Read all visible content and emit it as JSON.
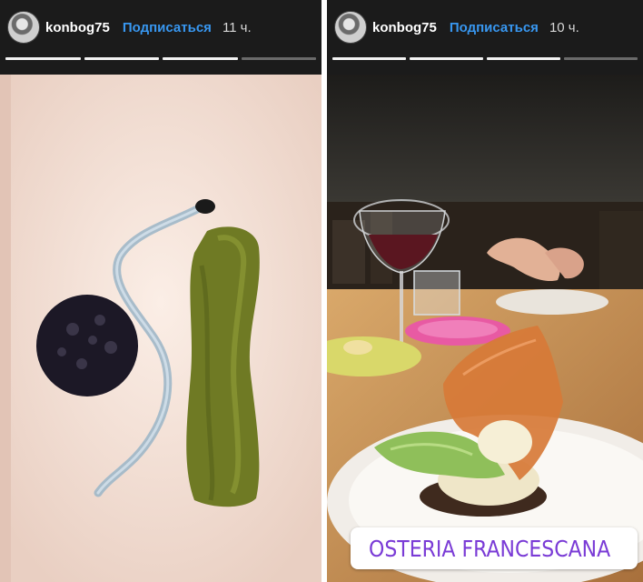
{
  "stories": [
    {
      "username": "konbog75",
      "subscribe_label": "Подписаться",
      "time": "11 ч.",
      "progress": {
        "segments": 4,
        "completed": 3
      }
    },
    {
      "username": "konbog75",
      "subscribe_label": "Подписаться",
      "time": "10 ч.",
      "progress": {
        "segments": 4,
        "completed": 3
      },
      "location": "OSTERIA FRANCESCANA"
    }
  ],
  "colors": {
    "subscribe_blue": "#3897f0",
    "location_purple": "#7a3bd6",
    "header_bg": "#1b1b1b"
  },
  "icons": [
    "location-pin-icon"
  ]
}
